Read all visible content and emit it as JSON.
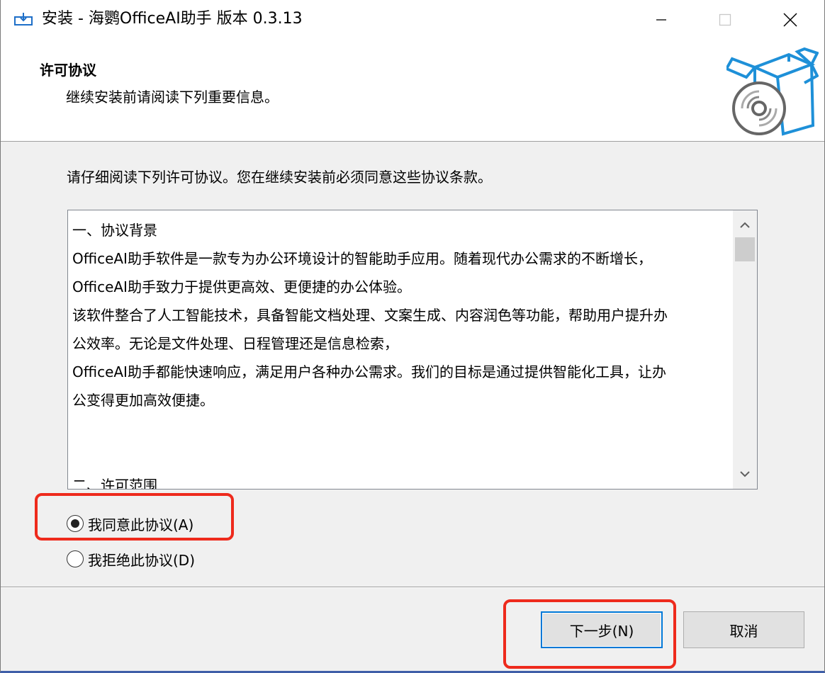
{
  "window": {
    "title": "安装 - 海鹦OfficeAI助手 版本 0.3.13",
    "controls": {
      "minimize": "minimize",
      "maximize": "maximize",
      "close": "close"
    }
  },
  "header": {
    "title": "许可协议",
    "subtitle": "继续安装前请阅读下列重要信息。"
  },
  "intro": "请仔细阅读下列许可协议。您在继续安装前必须同意这些协议条款。",
  "license": {
    "lines": [
      "一、协议背景",
      "OfficeAI助手软件是一款专为办公环境设计的智能助手应用。随着现代办公需求的不断增长，",
      "OfficeAI助手致力于提供更高效、更便捷的办公体验。",
      "该软件整合了人工智能技术，具备智能文档处理、文案生成、内容润色等功能，帮助用户提升办",
      "公效率。无论是文件处理、日程管理还是信息检索，",
      "OfficeAI助手都能快速响应，满足用户各种办公需求。我们的目标是通过提供智能化工具，让办",
      "公变得更加高效便捷。",
      "",
      "",
      "二、许可范围"
    ]
  },
  "options": {
    "agree": {
      "label": "我同意此协议(A)",
      "selected": true
    },
    "decline": {
      "label": "我拒绝此协议(D)",
      "selected": false
    }
  },
  "buttons": {
    "next": "下一步(N)",
    "cancel": "取消"
  },
  "colors": {
    "highlight": "#ee2a1c",
    "focus": "#0078d7",
    "icon_blue": "#1e90d8"
  },
  "icons": {
    "app": "installer-app-icon",
    "header": "software-box-cd-icon",
    "scroll_up": "chevron-up-icon",
    "scroll_down": "chevron-down-icon"
  }
}
